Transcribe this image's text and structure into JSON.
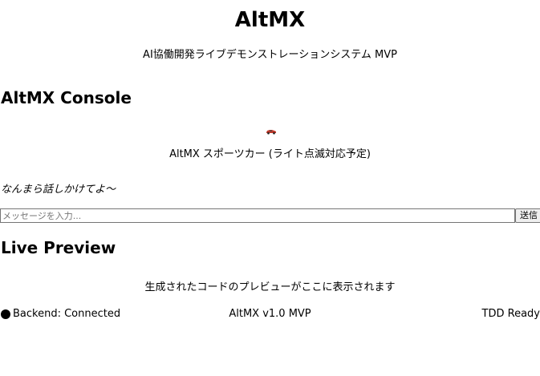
{
  "header": {
    "title": "AltMX",
    "subtitle": "AI協働開発ライブデモンストレーションシステム MVP"
  },
  "console": {
    "heading": "AltMX Console",
    "avatar_icon": "sports-car-icon",
    "avatar_caption": "AltMX スポーツカー (ライト点滅対応予定)",
    "greeting": "なんまら話しかけてよ〜",
    "input_placeholder": "メッセージを入力...",
    "input_value": "",
    "send_label": "送信"
  },
  "preview": {
    "heading": "Live Preview",
    "placeholder": "生成されたコードのプレビューがここに表示されます"
  },
  "status": {
    "indicator_icon": "status-dot-icon",
    "backend": "Backend: Connected",
    "version": "AltMX v1.0 MVP",
    "tdd": "TDD Ready",
    "colors": {
      "car_body": "#c0392b",
      "dot": "#000000"
    }
  }
}
